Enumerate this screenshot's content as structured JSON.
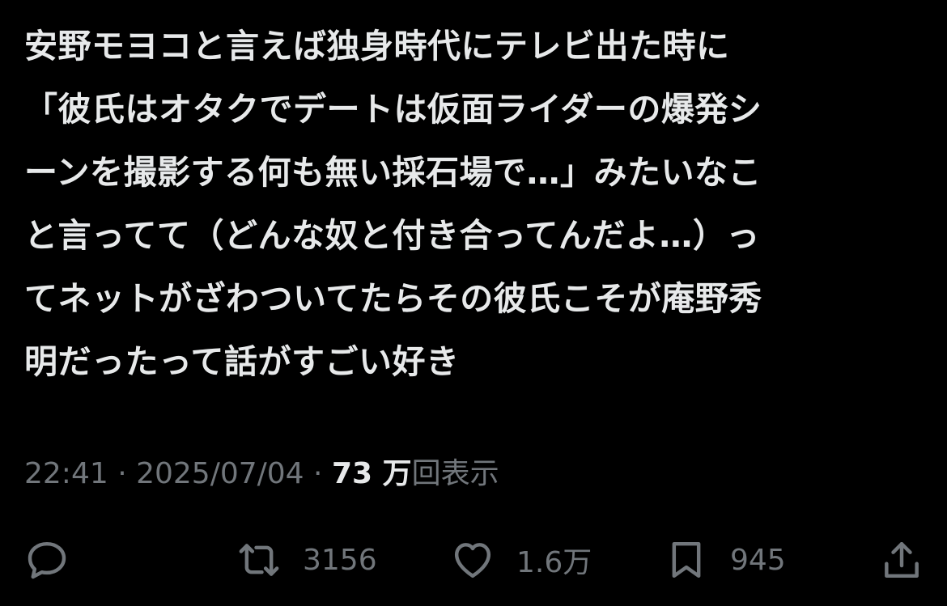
{
  "tweet": {
    "lines": [
      "安野モヨコと言えば独身時代にテレビ出た時に",
      "「彼氏はオタクでデートは仮面ライダーの爆発シ",
      "ーンを撮影する何も無い採石場で…」みたいなこ",
      "と言ってて（どんな奴と付き合ってんだよ…）っ",
      "てネットがざわついてたらその彼氏こそが庵野秀",
      "明だったって話がすごい好き"
    ]
  },
  "meta": {
    "time": "22:41",
    "separator": " · ",
    "date": "2025/07/04",
    "views_count": "73 万",
    "views_label": "回表示"
  },
  "actions": {
    "reply": {
      "icon": "reply-icon",
      "count": ""
    },
    "retweet": {
      "icon": "retweet-icon",
      "count": "3156"
    },
    "like": {
      "icon": "heart-icon",
      "count": "1.6万"
    },
    "bookmark": {
      "icon": "bookmark-icon",
      "count": "945"
    },
    "share": {
      "icon": "share-icon",
      "count": ""
    }
  },
  "colors": {
    "background": "#000000",
    "text": "#e7e9ea",
    "secondary": "#71767b"
  }
}
